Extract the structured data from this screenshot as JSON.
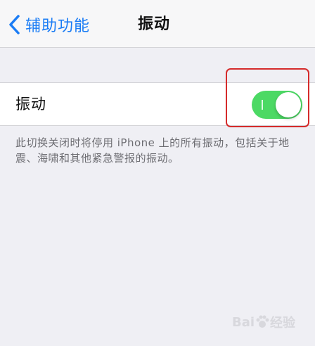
{
  "nav": {
    "back_label": "辅助功能",
    "title": "振动"
  },
  "settings": {
    "row_label": "振动",
    "toggle_state": "on",
    "toggle_color": "#4cd964",
    "footer_note": "此切换关闭时将停用 iPhone 上的所有振动，包括关于地震、海啸和其他紧急警报的振动。"
  },
  "colors": {
    "accent": "#1a7cf5",
    "annotation": "#d52b2b"
  },
  "watermark": {
    "text_a": "Bai",
    "text_b": "经验"
  }
}
